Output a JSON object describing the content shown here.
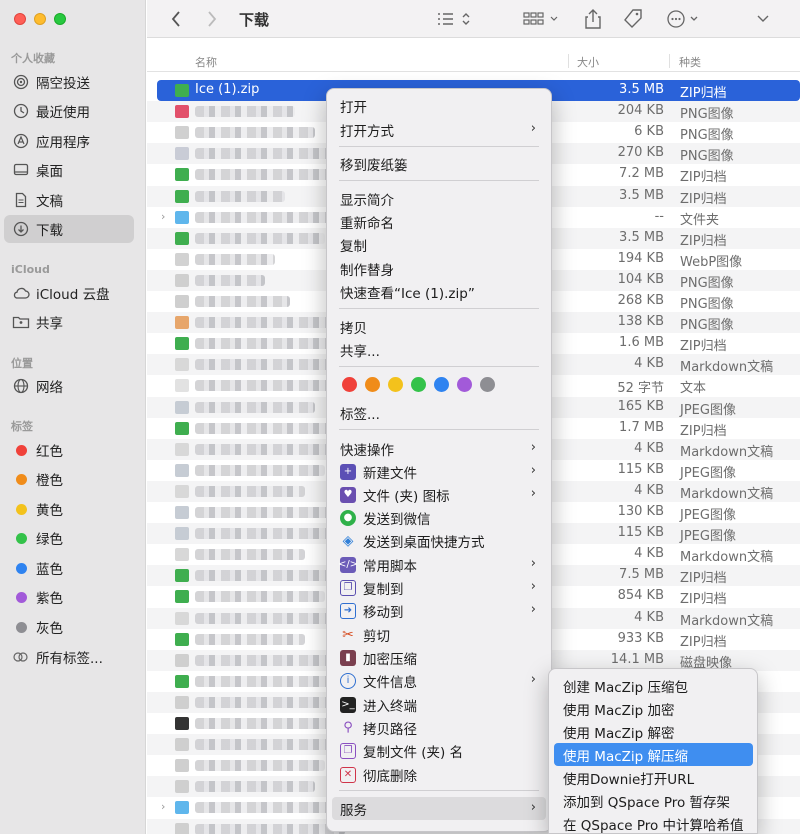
{
  "sidebar": {
    "sections": {
      "favorites": "个人收藏",
      "icloud": "iCloud",
      "locations": "位置",
      "tags": "标签"
    },
    "favorites": [
      "隔空投送",
      "最近使用",
      "应用程序",
      "桌面",
      "文稿",
      "下载"
    ],
    "icloud": [
      "iCloud 云盘",
      "共享"
    ],
    "locations": [
      "网络"
    ],
    "tags": [
      {
        "label": "红色",
        "color": "#f0413a"
      },
      {
        "label": "橙色",
        "color": "#f08c1a"
      },
      {
        "label": "黄色",
        "color": "#f3c21c"
      },
      {
        "label": "绿色",
        "color": "#34c24a"
      },
      {
        "label": "蓝色",
        "color": "#2f83f0"
      },
      {
        "label": "紫色",
        "color": "#a25ad9"
      },
      {
        "label": "灰色",
        "color": "#8e8e93"
      },
      {
        "label": "所有标签..."
      }
    ]
  },
  "toolbar": {
    "title": "下载"
  },
  "columns": {
    "name": "名称",
    "size": "大小",
    "kind": "种类"
  },
  "files": [
    {
      "name": "Ice (1).zip",
      "size": "3.5 MB",
      "kind": "ZIP归档",
      "icon": "#3fae4f"
    },
    {
      "size": "204 KB",
      "kind": "PNG图像",
      "icon": "#e2506a"
    },
    {
      "size": "6 KB",
      "kind": "PNG图像",
      "icon": "#d0d0d0"
    },
    {
      "size": "270 KB",
      "kind": "PNG图像",
      "icon": "#c9ccd6"
    },
    {
      "size": "7.2 MB",
      "kind": "ZIP归档",
      "icon": "#3fae4f"
    },
    {
      "size": "3.5 MB",
      "kind": "ZIP归档",
      "icon": "#3fae4f"
    },
    {
      "size": "--",
      "kind": "文件夹",
      "icon": "#5fb6ec"
    },
    {
      "size": "3.5 MB",
      "kind": "ZIP归档",
      "icon": "#3fae4f"
    },
    {
      "size": "194 KB",
      "kind": "WebP图像",
      "icon": "#d2d2d2"
    },
    {
      "size": "104 KB",
      "kind": "PNG图像",
      "icon": "#cfcfcf"
    },
    {
      "size": "268 KB",
      "kind": "PNG图像",
      "icon": "#cfcfcf"
    },
    {
      "size": "138 KB",
      "kind": "PNG图像",
      "icon": "#e7a66b"
    },
    {
      "size": "1.6 MB",
      "kind": "ZIP归档",
      "icon": "#3fae4f"
    },
    {
      "size": "4 KB",
      "kind": "Markdown文稿",
      "icon": "#d8d8d8"
    },
    {
      "size": "52 字节",
      "kind": "文本",
      "icon": "#e2e2e2"
    },
    {
      "size": "165 KB",
      "kind": "JPEG图像",
      "icon": "#c6ccd4"
    },
    {
      "size": "1.7 MB",
      "kind": "ZIP归档",
      "icon": "#3fae4f"
    },
    {
      "size": "4 KB",
      "kind": "Markdown文稿",
      "icon": "#d8d8d8"
    },
    {
      "size": "115 KB",
      "kind": "JPEG图像",
      "icon": "#c6ccd4"
    },
    {
      "size": "4 KB",
      "kind": "Markdown文稿",
      "icon": "#d8d8d8"
    },
    {
      "size": "130 KB",
      "kind": "JPEG图像",
      "icon": "#c6ccd4"
    },
    {
      "size": "115 KB",
      "kind": "JPEG图像",
      "icon": "#c6ccd4"
    },
    {
      "size": "4 KB",
      "kind": "Markdown文稿",
      "icon": "#d8d8d8"
    },
    {
      "size": "7.5 MB",
      "kind": "ZIP归档",
      "icon": "#3fae4f"
    },
    {
      "size": "854 KB",
      "kind": "ZIP归档",
      "icon": "#3fae4f"
    },
    {
      "size": "4 KB",
      "kind": "Markdown文稿",
      "icon": "#d8d8d8"
    },
    {
      "size": "933 KB",
      "kind": "ZIP归档",
      "icon": "#3fae4f"
    },
    {
      "size": "14.1 MB",
      "kind": "磁盘映像",
      "icon": "#cfcfcf"
    },
    {
      "size": "",
      "kind": "",
      "icon": "#3fae4f"
    },
    {
      "size": "",
      "kind": "",
      "icon": "#cfcfcf"
    },
    {
      "size": "",
      "kind": "",
      "icon": "#333333"
    },
    {
      "size": "",
      "kind": "",
      "icon": "#cfcfcf"
    },
    {
      "size": "",
      "kind": "",
      "icon": "#cfcfcf"
    },
    {
      "size": "",
      "kind": "",
      "icon": "#cfcfcf"
    },
    {
      "size": "",
      "kind": "",
      "icon": "#5fb6ec"
    },
    {
      "size": "",
      "kind": "",
      "icon": "#cfcfcf"
    }
  ],
  "context_menu": {
    "open": "打开",
    "open_with": "打开方式",
    "trash": "移到废纸篓",
    "get_info": "显示简介",
    "rename": "重新命名",
    "duplicate": "复制",
    "make_alias": "制作替身",
    "quick_look": "快速查看“Ice (1).zip”",
    "copy": "拷贝",
    "share": "共享...",
    "tags": "标签...",
    "tag_colors": [
      "#f0413a",
      "#f08c1a",
      "#f3c21c",
      "#34c24a",
      "#2f83f0",
      "#a25ad9",
      "#8e8e93"
    ],
    "quick_actions": "快速操作",
    "new_file": "新建文件",
    "folder_icon": "文件 (夹) 图标",
    "send_wechat": "发送到微信",
    "send_desktop": "发送到桌面快捷方式",
    "scripts": "常用脚本",
    "copy_to": "复制到",
    "move_to": "移动到",
    "cut": "剪切",
    "encrypt": "加密压缩",
    "file_info": "文件信息",
    "terminal": "进入终端",
    "copy_path": "拷贝路径",
    "copy_name": "复制文件 (夹) 名",
    "delete": "彻底删除",
    "services": "服务"
  },
  "services_menu": [
    "创建 MacZip 压缩包",
    "使用 MacZip 加密",
    "使用 MacZip 解密",
    "使用 MacZip 解压缩",
    "使用Downie打开URL",
    "添加到 QSpace Pro 暂存架",
    "在 QSpace Pro 中计算哈希值"
  ]
}
